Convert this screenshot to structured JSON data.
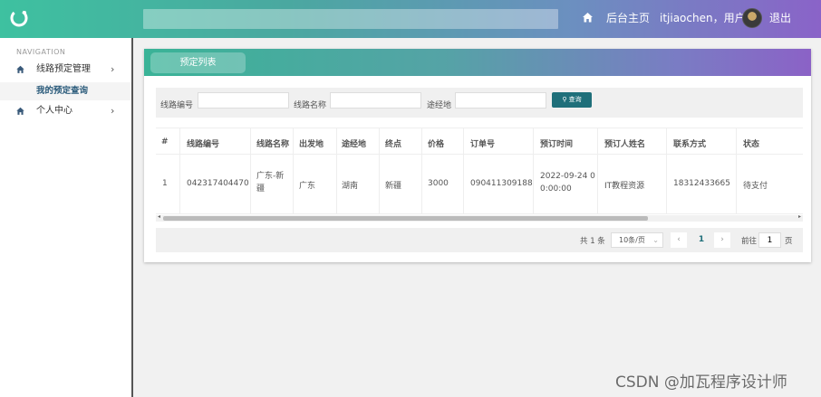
{
  "header": {
    "home_label": "后台主页",
    "user_label": "itjiaochen，用户",
    "logout_label": "退出"
  },
  "sidebar": {
    "nav_title": "NAVIGATION",
    "items": [
      {
        "label": "线路预定管理",
        "icon": "home-icon"
      },
      {
        "label": "我的预定查询"
      },
      {
        "label": "个人中心",
        "icon": "home-icon"
      }
    ]
  },
  "card": {
    "tab_label": "预定列表"
  },
  "search": {
    "route_no_label": "线路编号",
    "route_name_label": "线路名称",
    "via_label": "途经地",
    "button_label": "查询",
    "route_no_value": "",
    "route_name_value": "",
    "via_value": ""
  },
  "table": {
    "headers": [
      "#",
      "线路编号",
      "线路名称",
      "出发地",
      "途经地",
      "终点",
      "价格",
      "订单号",
      "预订时间",
      "预订人姓名",
      "联系方式",
      "状态"
    ],
    "rows": [
      {
        "index": "1",
        "route_no": "042317404470",
        "route_name_line1": "广东-新",
        "route_name_line2": "疆",
        "origin": "广东",
        "via": "湖南",
        "destination": "新疆",
        "price": "3000",
        "order_no": "090411309188",
        "time_line1": "2022-09-24 0",
        "time_line2": "0:00:00",
        "booker": "IT教程资源",
        "contact": "18312433665",
        "status": "待支付"
      }
    ]
  },
  "pager": {
    "total": "共 1 条",
    "page_size": "10条/页",
    "current_page": "1",
    "goto_label": "前往",
    "goto_value": "1",
    "page_unit": "页"
  },
  "watermark": "CSDN @加瓦程序设计师",
  "colors": {
    "accent": "#1f6f7a",
    "header_start": "#3ec1a0",
    "header_end": "#8a63c8"
  }
}
